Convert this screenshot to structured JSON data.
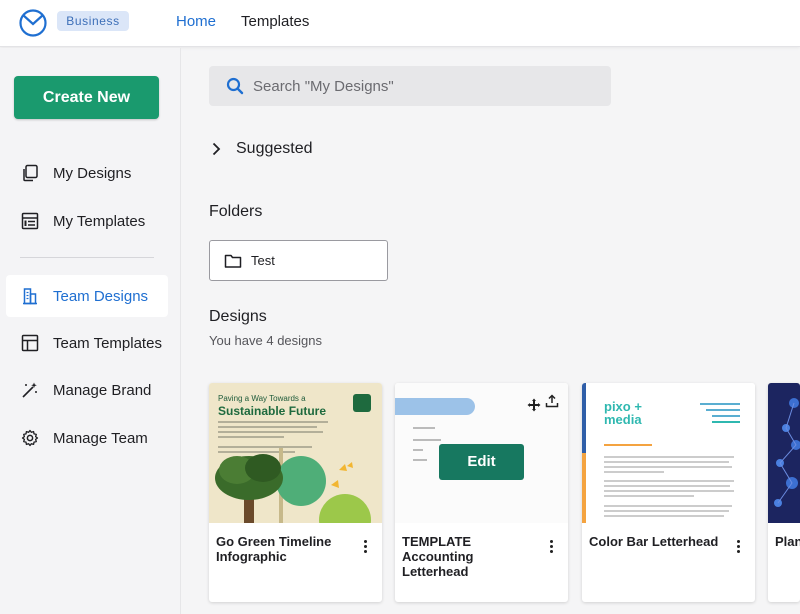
{
  "header": {
    "badge": "Business",
    "nav": [
      {
        "label": "Home"
      },
      {
        "label": "Templates"
      }
    ]
  },
  "sidebar": {
    "create_label": "Create New",
    "items": [
      {
        "label": "My Designs",
        "icon": "copy-icon"
      },
      {
        "label": "My Templates",
        "icon": "template-list-icon"
      },
      {
        "label": "Team Designs",
        "icon": "building-icon",
        "active": true
      },
      {
        "label": "Team Templates",
        "icon": "grid-layout-icon"
      },
      {
        "label": "Manage Brand",
        "icon": "magic-wand-icon"
      },
      {
        "label": "Manage Team",
        "icon": "gear-icon"
      }
    ]
  },
  "main": {
    "search_placeholder": "Search \"My Designs\"",
    "suggested_label": "Suggested",
    "folders_heading": "Folders",
    "folders": [
      {
        "label": "Test"
      }
    ],
    "designs_heading": "Designs",
    "designs_subtitle": "You have 4 designs",
    "edit_label": "Edit",
    "designs": [
      {
        "title": "Go Green Timeline Infographic",
        "thumb_heading_small": "Paving a Way Towards a",
        "thumb_heading": "Sustainable Future"
      },
      {
        "title": "TEMPLATE Accounting Letterhead"
      },
      {
        "title": "Color Bar Letterhead",
        "thumb_brand": "pixo + media"
      },
      {
        "title": "Plan"
      }
    ]
  },
  "colors": {
    "accent": "#1f6fd1",
    "create_button": "#1a9a6e",
    "edit_button": "#177860"
  }
}
